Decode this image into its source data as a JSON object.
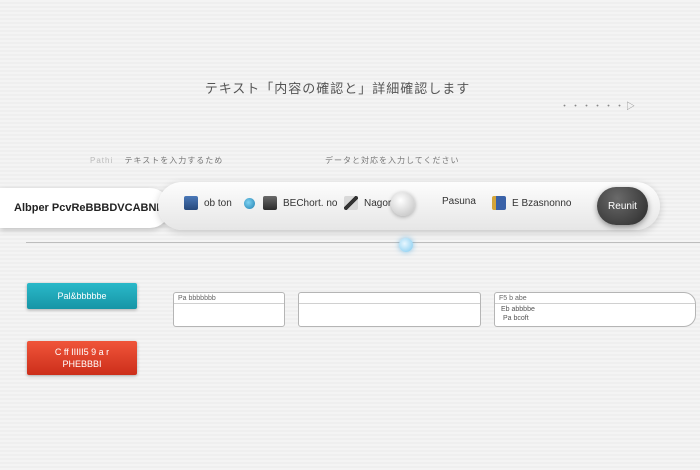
{
  "header": {
    "title": "テキスト「内容の確認と」詳細確認します",
    "meta": "・・・・・・▷"
  },
  "sub_header": {
    "left_muted": "Pathi",
    "left": "テキストを入力するため",
    "right": "データと対応を入力してください"
  },
  "brand": {
    "label": "Albper PcvReBBBDVCABNI"
  },
  "toolbar": {
    "items": [
      {
        "icon": "blue-document-icon",
        "label": "ob ton"
      },
      {
        "icon": "dark-book-icon",
        "label": "BEChort. no"
      },
      {
        "icon": "tools-icon",
        "label": "Nagoro"
      },
      {
        "icon": "none",
        "label": "Pasuna"
      },
      {
        "icon": "gold-doc-icon",
        "label": "E Bzasnonno"
      }
    ],
    "primary_label": "Reunit"
  },
  "left_buttons": {
    "teal_label": "Pal&bbbbbe",
    "red_label_line1": "C ff IIIII5 9 a r",
    "red_label_line2": "PHEBBBI"
  },
  "fields": [
    {
      "header": "Pa bbbbbbb",
      "value": ""
    },
    {
      "header": "",
      "value": ""
    },
    {
      "header": "F5 b abe",
      "value": "Eb abbbbe",
      "value2": "Pa bcoft"
    }
  ],
  "colors": {
    "teal": "#1fa8b8",
    "red": "#e0442a",
    "primary_dark": "#3a3a3a"
  }
}
